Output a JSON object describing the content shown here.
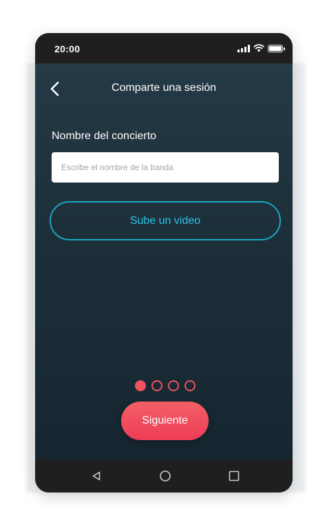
{
  "status_bar": {
    "time": "20:00",
    "icons": [
      "signal-icon",
      "wifi-icon",
      "battery-icon"
    ]
  },
  "header": {
    "back_icon": "chevron-left-icon",
    "title": "Comparte una sesión"
  },
  "form": {
    "field_label": "Nombre del concierto",
    "input_value": "",
    "input_placeholder": "Escribe el nombre de la banda",
    "upload_label": "Sube un video"
  },
  "pager": {
    "total": 4,
    "active_index": 0
  },
  "footer": {
    "next_label": "Siguiente"
  },
  "nav_bar": {
    "icons": [
      "nav-back-icon",
      "nav-home-icon",
      "nav-recents-icon"
    ]
  },
  "colors": {
    "accent_cyan": "#2bc4e6",
    "accent_coral": "#f0525f",
    "screen_bg": "#1c2f39"
  }
}
